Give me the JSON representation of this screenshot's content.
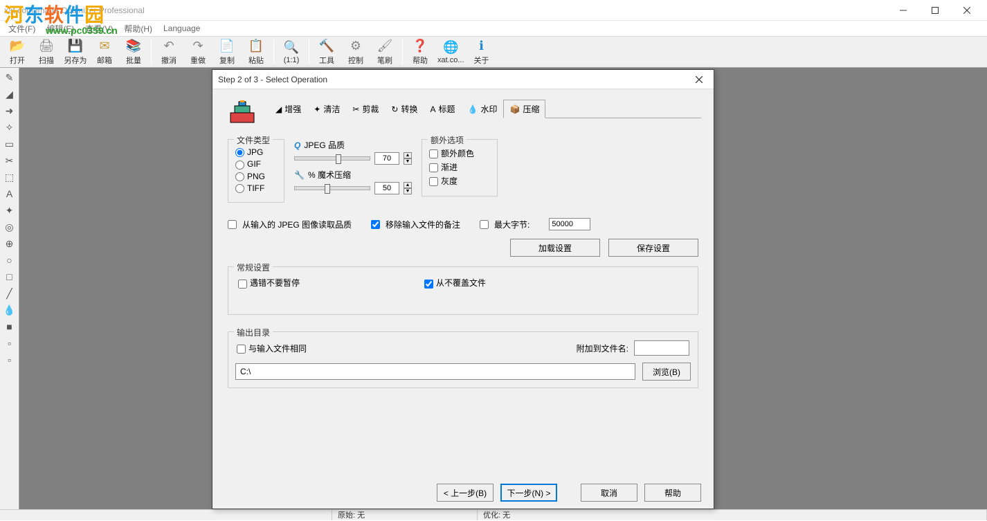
{
  "window": {
    "title": "xat.com  Image Optimizer Professional"
  },
  "menu": {
    "items": [
      "文件(F)",
      "编辑(E)",
      "查看(V)",
      "帮助(H)",
      "Language"
    ]
  },
  "toolbar": {
    "items": [
      {
        "label": "打开",
        "icon": "📂",
        "color": "#d4a017"
      },
      {
        "label": "扫描",
        "icon": "🖨",
        "color": "#888"
      },
      {
        "label": "另存为",
        "icon": "💾",
        "color": "#2a8"
      },
      {
        "label": "邮箱",
        "icon": "✉",
        "color": "#c49a3a"
      },
      {
        "label": "批量",
        "icon": "📚",
        "color": "#c44"
      },
      {
        "sep": true
      },
      {
        "label": "撤消",
        "icon": "↶",
        "color": "#888"
      },
      {
        "label": "重做",
        "icon": "↷",
        "color": "#888"
      },
      {
        "label": "复制",
        "icon": "📄",
        "color": "#888"
      },
      {
        "label": "粘贴",
        "icon": "📋",
        "color": "#888"
      },
      {
        "sep": true
      },
      {
        "label": "(1:1)",
        "icon": "🔍",
        "color": "#888"
      },
      {
        "sep": true
      },
      {
        "label": "工具",
        "icon": "🔨",
        "color": "#5a8"
      },
      {
        "label": "控制",
        "icon": "⚙",
        "color": "#888"
      },
      {
        "label": "笔刷",
        "icon": "🖌",
        "color": "#888"
      },
      {
        "sep": true
      },
      {
        "label": "帮助",
        "icon": "❓",
        "color": "#28c"
      },
      {
        "label": "xat.co...",
        "icon": "🌐",
        "color": "#28c"
      },
      {
        "label": "关于",
        "icon": "ℹ",
        "color": "#28c"
      }
    ]
  },
  "sidebar": {
    "tools": [
      "✎",
      "◢",
      "➜",
      "✧",
      "▭",
      "✂",
      "⬚",
      "A",
      "✦",
      "◎",
      "⊕",
      "○",
      "□",
      "╱",
      "💧",
      "■",
      "▫",
      "▫"
    ]
  },
  "dialog": {
    "title": "Step 2 of 3 - Select Operation",
    "tabs": [
      {
        "label": "增强",
        "icon": "◢"
      },
      {
        "label": "清洁",
        "icon": "✦"
      },
      {
        "label": "剪裁",
        "icon": "✂"
      },
      {
        "label": "转换",
        "icon": "↻"
      },
      {
        "label": "标题",
        "icon": "A"
      },
      {
        "label": "水印",
        "icon": "💧"
      },
      {
        "label": "压缩",
        "icon": "📦",
        "active": true
      }
    ],
    "filetype": {
      "legend": "文件类型",
      "options": [
        "JPG",
        "GIF",
        "PNG",
        "TIFF"
      ],
      "selected": "JPG"
    },
    "quality": {
      "label": "JPEG 品质",
      "icon": "Q",
      "value": "70"
    },
    "magic": {
      "label": "% 魔术压缩",
      "icon": "🔧",
      "value": "50"
    },
    "extra": {
      "legend": "额外选项",
      "options": [
        {
          "label": "额外颜色",
          "checked": false
        },
        {
          "label": "渐进",
          "checked": false
        },
        {
          "label": "灰度",
          "checked": false
        }
      ]
    },
    "read_quality": {
      "label": "从输入的 JPEG 图像读取品质",
      "checked": false
    },
    "remove_comment": {
      "label": "移除输入文件的备注",
      "checked": true
    },
    "max_bytes": {
      "label": "最大字节:",
      "checked": false,
      "value": "50000"
    },
    "load_btn": "加载设置",
    "save_btn": "保存设置",
    "general": {
      "legend": "常规设置",
      "no_pause": {
        "label": "遇错不要暂停",
        "checked": false
      },
      "no_overwrite": {
        "label": "从不覆盖文件",
        "checked": true
      }
    },
    "output": {
      "legend": "输出目录",
      "same_as_input": {
        "label": "与输入文件相同",
        "checked": false
      },
      "append_label": "附加到文件名:",
      "append_value": "",
      "path": "C:\\",
      "browse_btn": "浏览(B)"
    },
    "footer": {
      "back": "< 上一步(B)",
      "next": "下一步(N) >",
      "cancel": "取消",
      "help": "帮助"
    }
  },
  "status": {
    "left": "原始: 无",
    "right": "优化: 无"
  },
  "watermark": {
    "line1": "河东软件园",
    "line2": "www.pc0359.cn"
  }
}
